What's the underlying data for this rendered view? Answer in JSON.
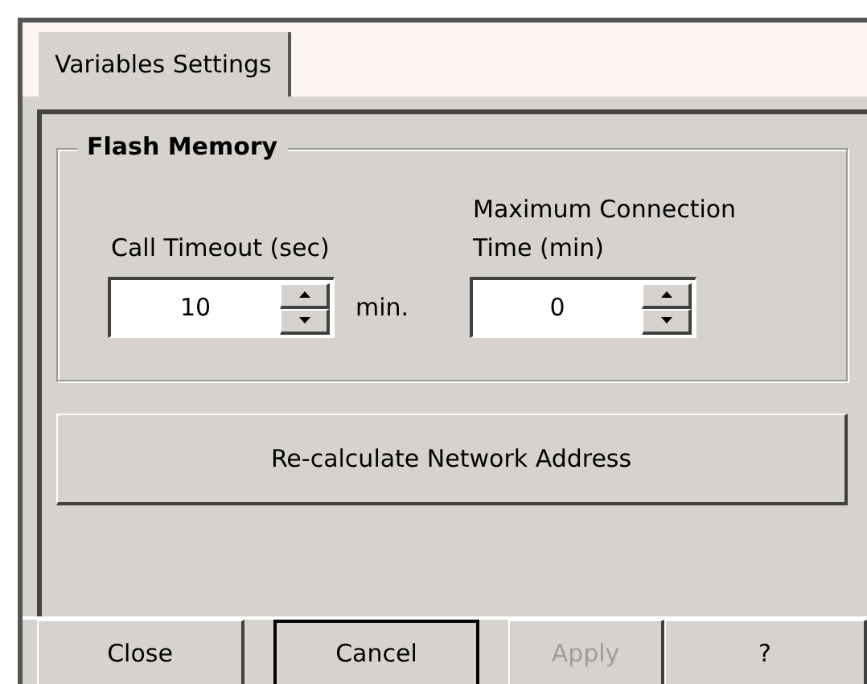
{
  "tabs": [
    {
      "label": "Variables Settings",
      "selected": true
    }
  ],
  "group": {
    "title": "Flash Memory",
    "fields": [
      {
        "label": "Call Timeout (sec)",
        "value": "10",
        "unit": "min."
      },
      {
        "label": "Maximum Connection Time (min)",
        "value": "0"
      }
    ]
  },
  "action_button": {
    "label": "Re-calculate Network Address"
  },
  "buttons": [
    {
      "label": "Close",
      "default": false,
      "disabled": false
    },
    {
      "label": "Cancel",
      "default": true,
      "disabled": false
    },
    {
      "label": "Apply",
      "default": false,
      "disabled": true
    },
    {
      "label": "?",
      "default": false,
      "disabled": false
    }
  ]
}
